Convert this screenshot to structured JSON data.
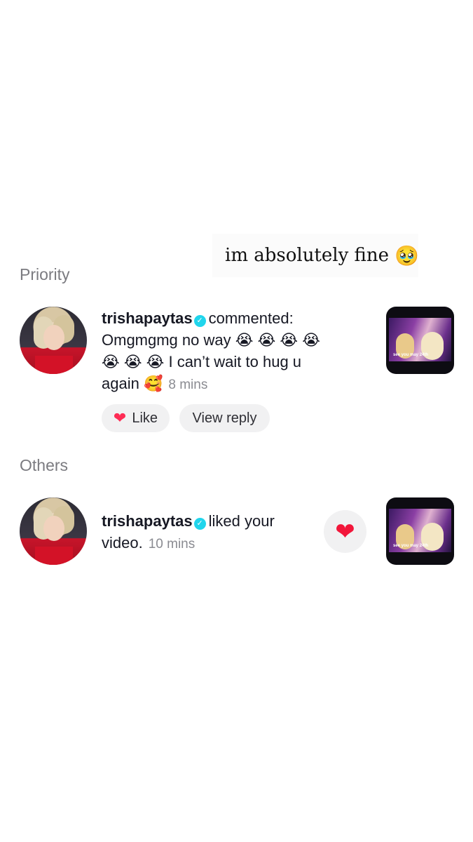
{
  "caption": {
    "text": "im absolutely fine",
    "emoji": "🥹"
  },
  "sections": {
    "priority": "Priority",
    "others": "Others"
  },
  "comment": {
    "username": "trishapaytas",
    "action": "commented:",
    "line1": "Omgmgmg no way",
    "emojis1": "😭 😭 😭 😭",
    "emojis2": "😭 😭 😭",
    "line2": "I can’t wait to hug u",
    "line3": "again",
    "emoji3": "🥰",
    "time": "8 mins",
    "like_label": "Like",
    "reply_label": "View reply",
    "thumb_caption": "see you may 24th"
  },
  "like": {
    "username": "trishapaytas",
    "action": "liked your",
    "action2": "video.",
    "time": "10 mins",
    "thumb_caption": "see you may 24th"
  },
  "colors": {
    "verified": "#20d5ec",
    "heart": "#fe2c55",
    "secondary_text": "#8a8b91"
  }
}
